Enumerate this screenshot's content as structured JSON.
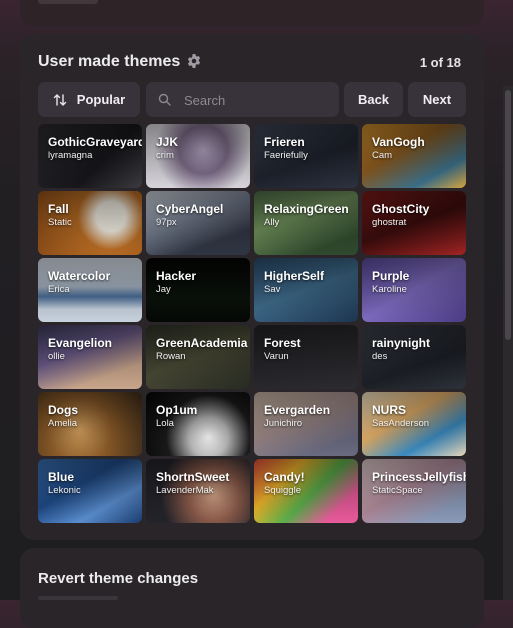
{
  "section": {
    "title": "User made themes",
    "pager": "1 of 18"
  },
  "toolbar": {
    "sort_label": "Popular",
    "search_placeholder": "Search",
    "back_label": "Back",
    "next_label": "Next"
  },
  "themes": [
    {
      "name": "GothicGraveyard",
      "author": "lyramagna",
      "bg": "linear-gradient(135deg,#2a2a2e,#16161a 60%,#3b3b40)"
    },
    {
      "name": "JJK",
      "author": "crim",
      "bg": "radial-gradient(circle at 55% 40%,#b7a9c6 0%,#7b6a86 35%,#d6d4da 70%)"
    },
    {
      "name": "Frieren",
      "author": "Faeriefully",
      "bg": "linear-gradient(160deg,#3b4252,#1e222c 55%,#2c3240)"
    },
    {
      "name": "VanGogh",
      "author": "Cam",
      "bg": "linear-gradient(150deg,#c88a2a,#8a5a1f 40%,#3a6f8a 75%,#d8a53e)"
    },
    {
      "name": "Fall",
      "author": "Static",
      "bg": "radial-gradient(circle at 70% 40%,#f1ede2 0 18%,#b56a23 40%,#8c4d18 100%)"
    },
    {
      "name": "CyberAngel",
      "author": "97px",
      "bg": "linear-gradient(160deg,#c7ccd6,#7a8394 40%,#2f3542 75%)"
    },
    {
      "name": "RelaxingGreen",
      "author": "Ally",
      "bg": "linear-gradient(160deg,#4a6a44,#6f8f5a 40%,#304a2e 80%)"
    },
    {
      "name": "GhostCity",
      "author": "ghostrat",
      "bg": "linear-gradient(160deg,#7a1a1a,#3a0c0c 50%,#a42424)"
    },
    {
      "name": "Watercolor",
      "author": "Erica",
      "bg": "linear-gradient(180deg,#d7dde6 0%,#aab8c8 45%,#4a6f9a 60%,#c7d2de 80%)"
    },
    {
      "name": "Hacker",
      "author": "Jay",
      "bg": "linear-gradient(180deg,#040504,#0b120b 60%,#050805)"
    },
    {
      "name": "HigherSelf",
      "author": "Sav",
      "bg": "linear-gradient(160deg,#2a4a6a,#3f6c8c 50%,#1c3450)"
    },
    {
      "name": "Purple",
      "author": "Karoline",
      "bg": "linear-gradient(150deg,#5a4a9a,#7e6cc0 50%,#4a3b86)"
    },
    {
      "name": "Evangelion",
      "author": "ollie",
      "bg": "linear-gradient(160deg,#3a3a5a,#6a5a8a 40%,#c8a58a 75%)"
    },
    {
      "name": "GreenAcademia",
      "author": "Rowan",
      "bg": "linear-gradient(160deg,#2e3328,#4a4a36 50%,#262a22)"
    },
    {
      "name": "Forest",
      "author": "Varun",
      "bg": "linear-gradient(160deg,#222226,#2c2c30)"
    },
    {
      "name": "rainynight",
      "author": "des",
      "bg": "linear-gradient(160deg,#3a3e48,#1c1f26 60%,#2e323a)"
    },
    {
      "name": "Dogs",
      "author": "Amelia",
      "bg": "radial-gradient(circle at 40% 60%,#d9a460 0%,#8a5a28 45%,#3a2a18 100%)"
    },
    {
      "name": "Op1um",
      "author": "Lola",
      "bg": "radial-gradient(circle at 60% 70%,#ffffff 0%,#bdbdbd 25%,#1a1a1a 55%,#050505 100%)"
    },
    {
      "name": "Evergarden",
      "author": "Junichiro",
      "bg": "linear-gradient(160deg,#c7b5a3,#9f8a88 45%,#6a6a80 80%)"
    },
    {
      "name": "NURS",
      "author": "SasAnderson",
      "bg": "linear-gradient(150deg,#f0e2c3,#e9b36a 40%,#3a8ac0 70%,#e9d8b8)"
    },
    {
      "name": "Blue",
      "author": "Lekonic",
      "bg": "linear-gradient(150deg,#3a6fb0,#1f4a86 40%,#5a8ed0 70%,#1a3c70)"
    },
    {
      "name": "ShortnSweet",
      "author": "LavenderMak",
      "bg": "radial-gradient(circle at 65% 55%,#d8a88a 0%,#8a5a4a 35%,#23232a 70%)"
    },
    {
      "name": "Candy!",
      "author": "Squiggle",
      "bg": "linear-gradient(135deg,#e44a3a,#f0b52a 30%,#5ab04a 55%,#e85a9a 80%)"
    },
    {
      "name": "PrincessJellyfish",
      "author": "StaticSpace",
      "bg": "linear-gradient(150deg,#d9c6c6,#b08a9a 45%,#8a9ab8 80%)"
    }
  ],
  "next_section": {
    "title": "Revert theme changes"
  },
  "colors": {
    "page_bg": "#1e1d20",
    "card_bg": "#2a2529",
    "control_bg": "#38333a"
  }
}
